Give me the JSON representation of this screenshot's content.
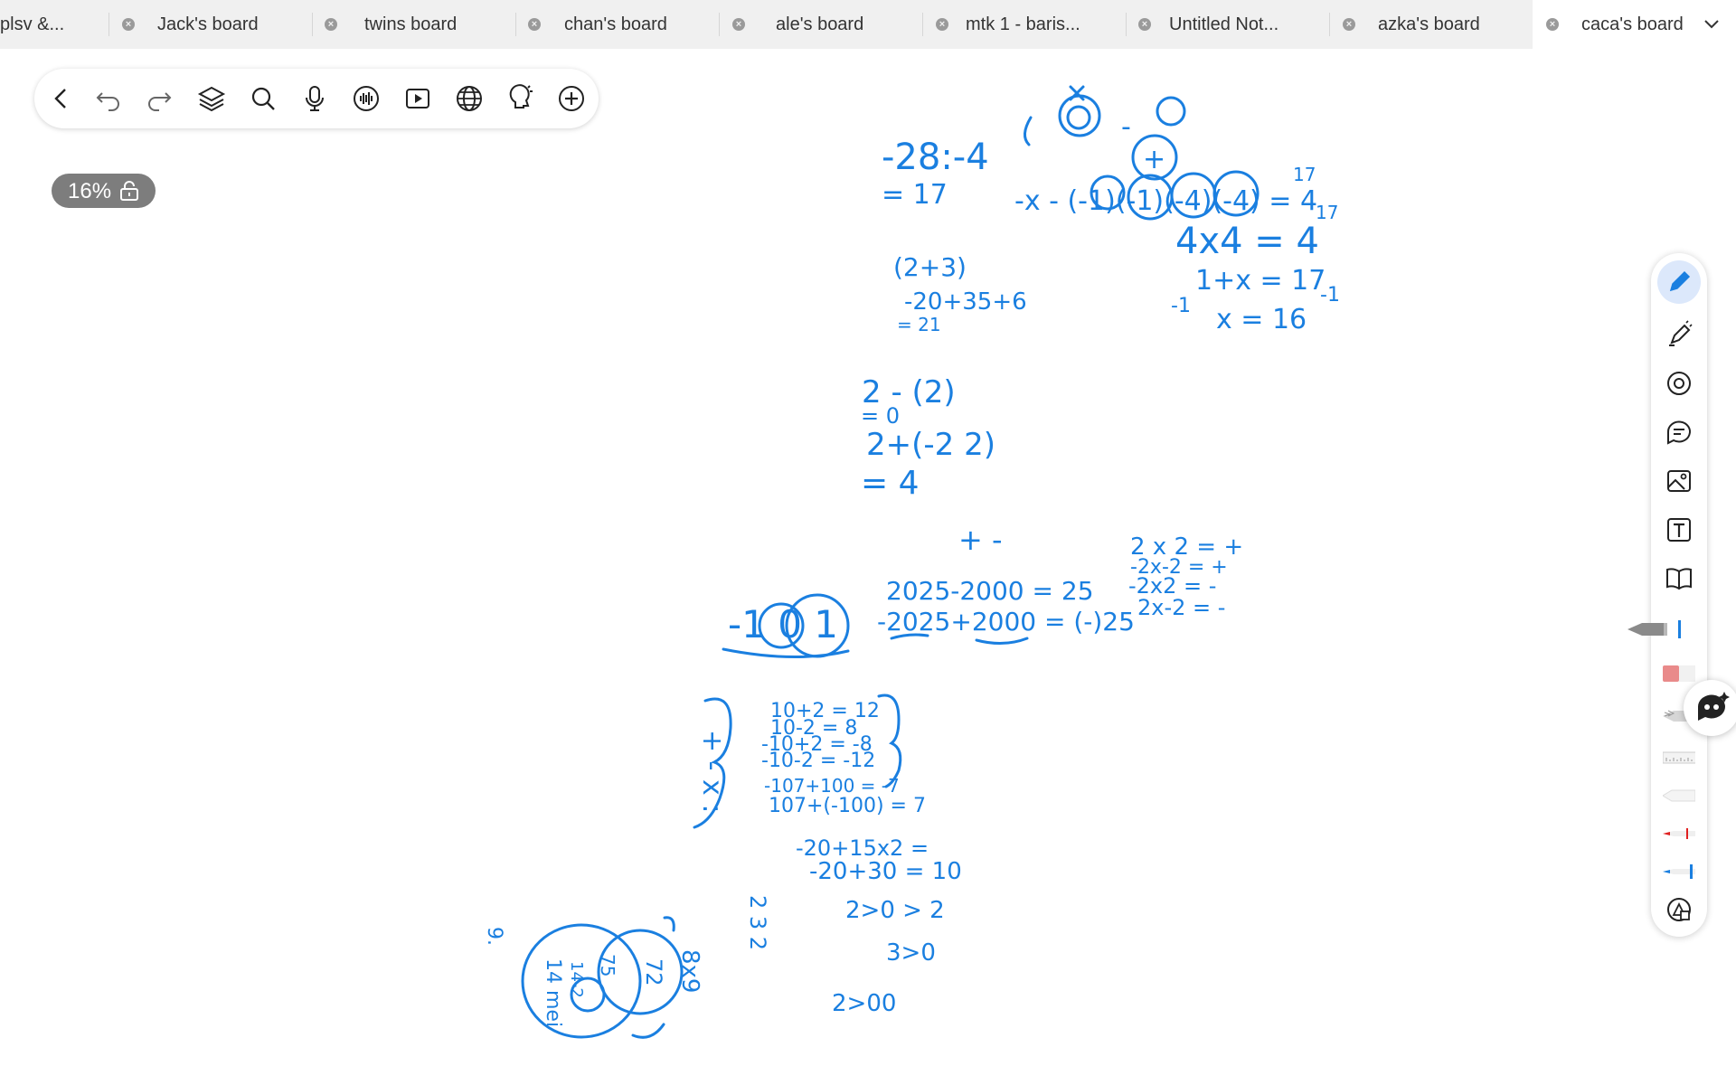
{
  "tabs": [
    {
      "label": "plsv &...",
      "active": false
    },
    {
      "label": "Jack's board",
      "active": false
    },
    {
      "label": "twins board",
      "active": false
    },
    {
      "label": "chan's board",
      "active": false
    },
    {
      "label": "ale's board",
      "active": false
    },
    {
      "label": "mtk 1 - baris...",
      "active": false
    },
    {
      "label": "Untitled Not...",
      "active": false
    },
    {
      "label": "azka's board",
      "active": false
    },
    {
      "label": "caca's board",
      "active": true
    }
  ],
  "toolbar": {
    "icons": [
      "back-icon",
      "undo-icon",
      "redo-icon",
      "layers-icon",
      "search-icon",
      "microphone-icon",
      "audio-wave-icon",
      "video-play-icon",
      "globe-icon",
      "lightbulb-icon",
      "add-icon"
    ]
  },
  "zoom": {
    "level": "16%",
    "icon": "lock-icon"
  },
  "palette": {
    "icons": [
      "pen-icon",
      "highlighter-icon",
      "lasso-icon",
      "sticky-note-icon",
      "image-icon",
      "text-icon",
      "book-icon",
      "fountain-pen-tool",
      "eraser-tool",
      "pencil-tool",
      "ruler-tool",
      "marker-tool",
      "red-pen-tool",
      "blue-pen-tool",
      "shape-icon"
    ],
    "active": "pen-icon",
    "assistant_icon": "ai-assistant-icon"
  },
  "ink_color": "#1a7fe0",
  "handwriting": {
    "line1a": "-28:-4",
    "line1b": "= 17",
    "line2": "-x - (-1)(-1)(-4)(-4) = 4",
    "line3": "4x4 = 4",
    "line4": "1+x = 17",
    "line5": "x = 16",
    "exp17a": "17",
    "exp17b": "17",
    "minus1a": "-1",
    "minus1b": "-1",
    "circ_plus": "+",
    "circ_mins": "-",
    "paren1": "(2+3)",
    "paren2": "-20+35+6",
    "paren3": "= 21",
    "b1": "2 - (2)",
    "b2": "= 0",
    "b3": "2+(-2 2)",
    "b4": "= 4",
    "pm": "+  -",
    "c1": "2025-2000 = 25",
    "c2": "-2025+2000 = (-)25",
    "s1": "2 x 2 = +",
    "s2": "-2x-2 = +",
    "s3": "-2x2 = -",
    "s4": "2x-2 = -",
    "big": "-1 0 1",
    "ops": "+  -  x  :",
    "d1": "10+2 = 12",
    "d2": "10-2 = 8",
    "d3": "-10+2 = -8",
    "d4": "-10-2 = -12",
    "d5": "-107+100 = -7",
    "d6": "107+(-100) = 7",
    "e1": "-20+15x2 =",
    "e2": "-20+30 = 10",
    "f1": "2 3 2",
    "f2": "2>0 > 2",
    "f3": "3>0",
    "f4": "2>00",
    "g1": "8x9",
    "g2": "72",
    "g3": "75",
    "g4": "14-2",
    "g5": "14 mei",
    "g6": "9."
  }
}
